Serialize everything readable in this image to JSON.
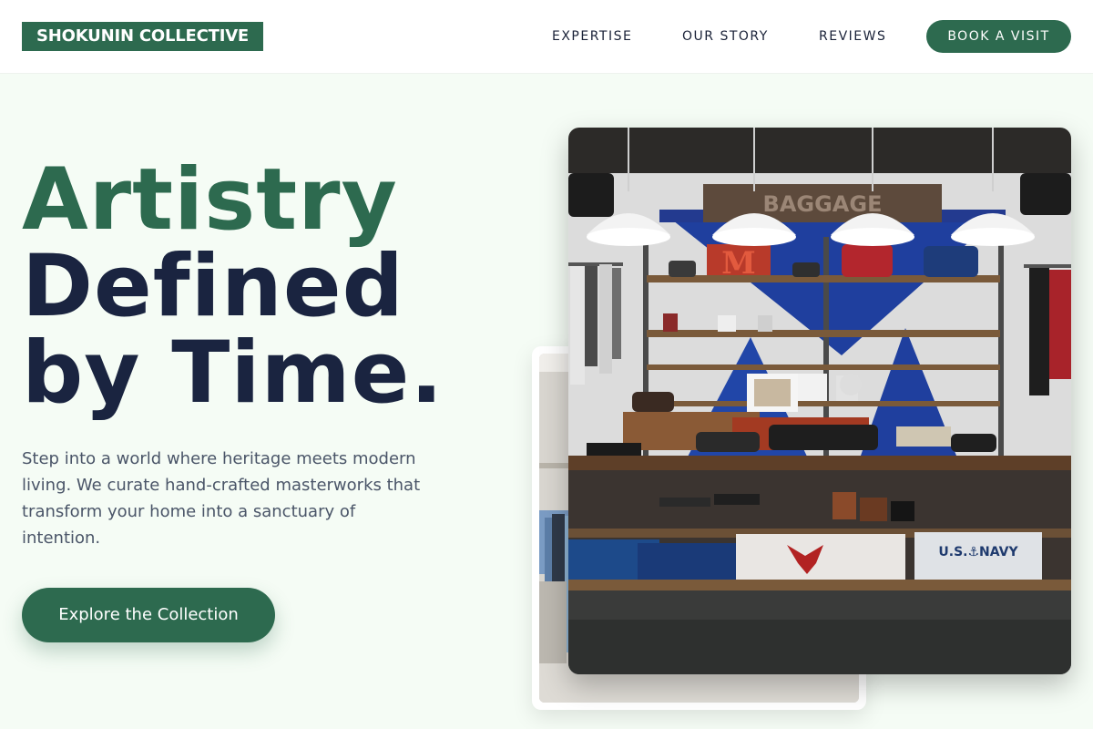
{
  "header": {
    "logo": "SHOKUNIN COLLECTIVE",
    "nav": [
      {
        "label": "EXPERTISE"
      },
      {
        "label": "OUR STORY"
      },
      {
        "label": "REVIEWS"
      }
    ],
    "cta_label": "BOOK A VISIT"
  },
  "hero": {
    "title_line1": "Artistry",
    "title_line2": "Defined",
    "title_line3": "by Time.",
    "description": "Step into a world where heritage meets modern living. We curate hand-crafted masterworks that transform your home into a sanctuary of intention.",
    "cta_label": "Explore the Collection"
  },
  "photo": {
    "shop_sign": "BAGGAGE",
    "letter_sign": "M",
    "sweater_text": "U.S.⚓NAVY"
  },
  "colors": {
    "brand": "#2d6a4f",
    "heading_dark": "#1a2440",
    "body_text": "#4a5568",
    "background": "#f5fcf5"
  }
}
